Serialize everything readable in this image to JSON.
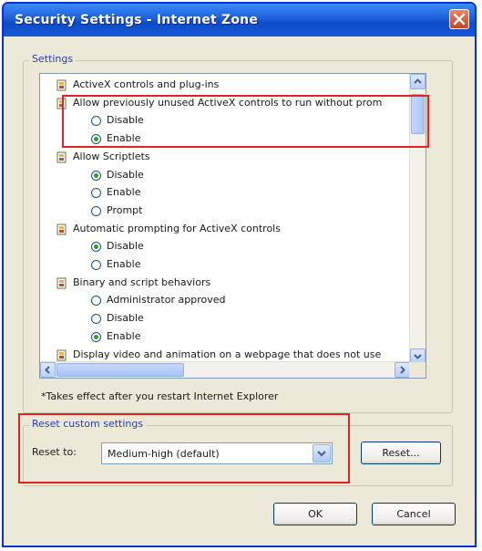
{
  "window": {
    "title": "Security Settings - Internet Zone",
    "close_label": "Close"
  },
  "settings_group": {
    "legend": "Settings",
    "items": [
      {
        "type": "category",
        "label": "ActiveX controls and plug-ins"
      },
      {
        "type": "category",
        "label": "Allow previously unused ActiveX controls to run without prom"
      },
      {
        "type": "option",
        "label": "Disable",
        "selected": false
      },
      {
        "type": "option",
        "label": "Enable",
        "selected": true
      },
      {
        "type": "category",
        "label": "Allow Scriptlets"
      },
      {
        "type": "option",
        "label": "Disable",
        "selected": true
      },
      {
        "type": "option",
        "label": "Enable",
        "selected": false
      },
      {
        "type": "option",
        "label": "Prompt",
        "selected": false
      },
      {
        "type": "category",
        "label": "Automatic prompting for ActiveX controls"
      },
      {
        "type": "option",
        "label": "Disable",
        "selected": true
      },
      {
        "type": "option",
        "label": "Enable",
        "selected": false
      },
      {
        "type": "category",
        "label": "Binary and script behaviors"
      },
      {
        "type": "option",
        "label": "Administrator approved",
        "selected": false
      },
      {
        "type": "option",
        "label": "Disable",
        "selected": false
      },
      {
        "type": "option",
        "label": "Enable",
        "selected": true
      },
      {
        "type": "category",
        "label": "Display video and animation on a webpage that does not use"
      }
    ],
    "note": "*Takes effect after you restart Internet Explorer"
  },
  "reset_group": {
    "legend": "Reset custom settings",
    "reset_to_label": "Reset to:",
    "reset_to_value": "Medium-high (default)",
    "reset_button": "Reset..."
  },
  "footer": {
    "ok": "OK",
    "cancel": "Cancel"
  },
  "colors": {
    "title_bar": "#1f5fd8",
    "highlight_box": "#e02424",
    "radio_selected": "#2e9d2e"
  }
}
